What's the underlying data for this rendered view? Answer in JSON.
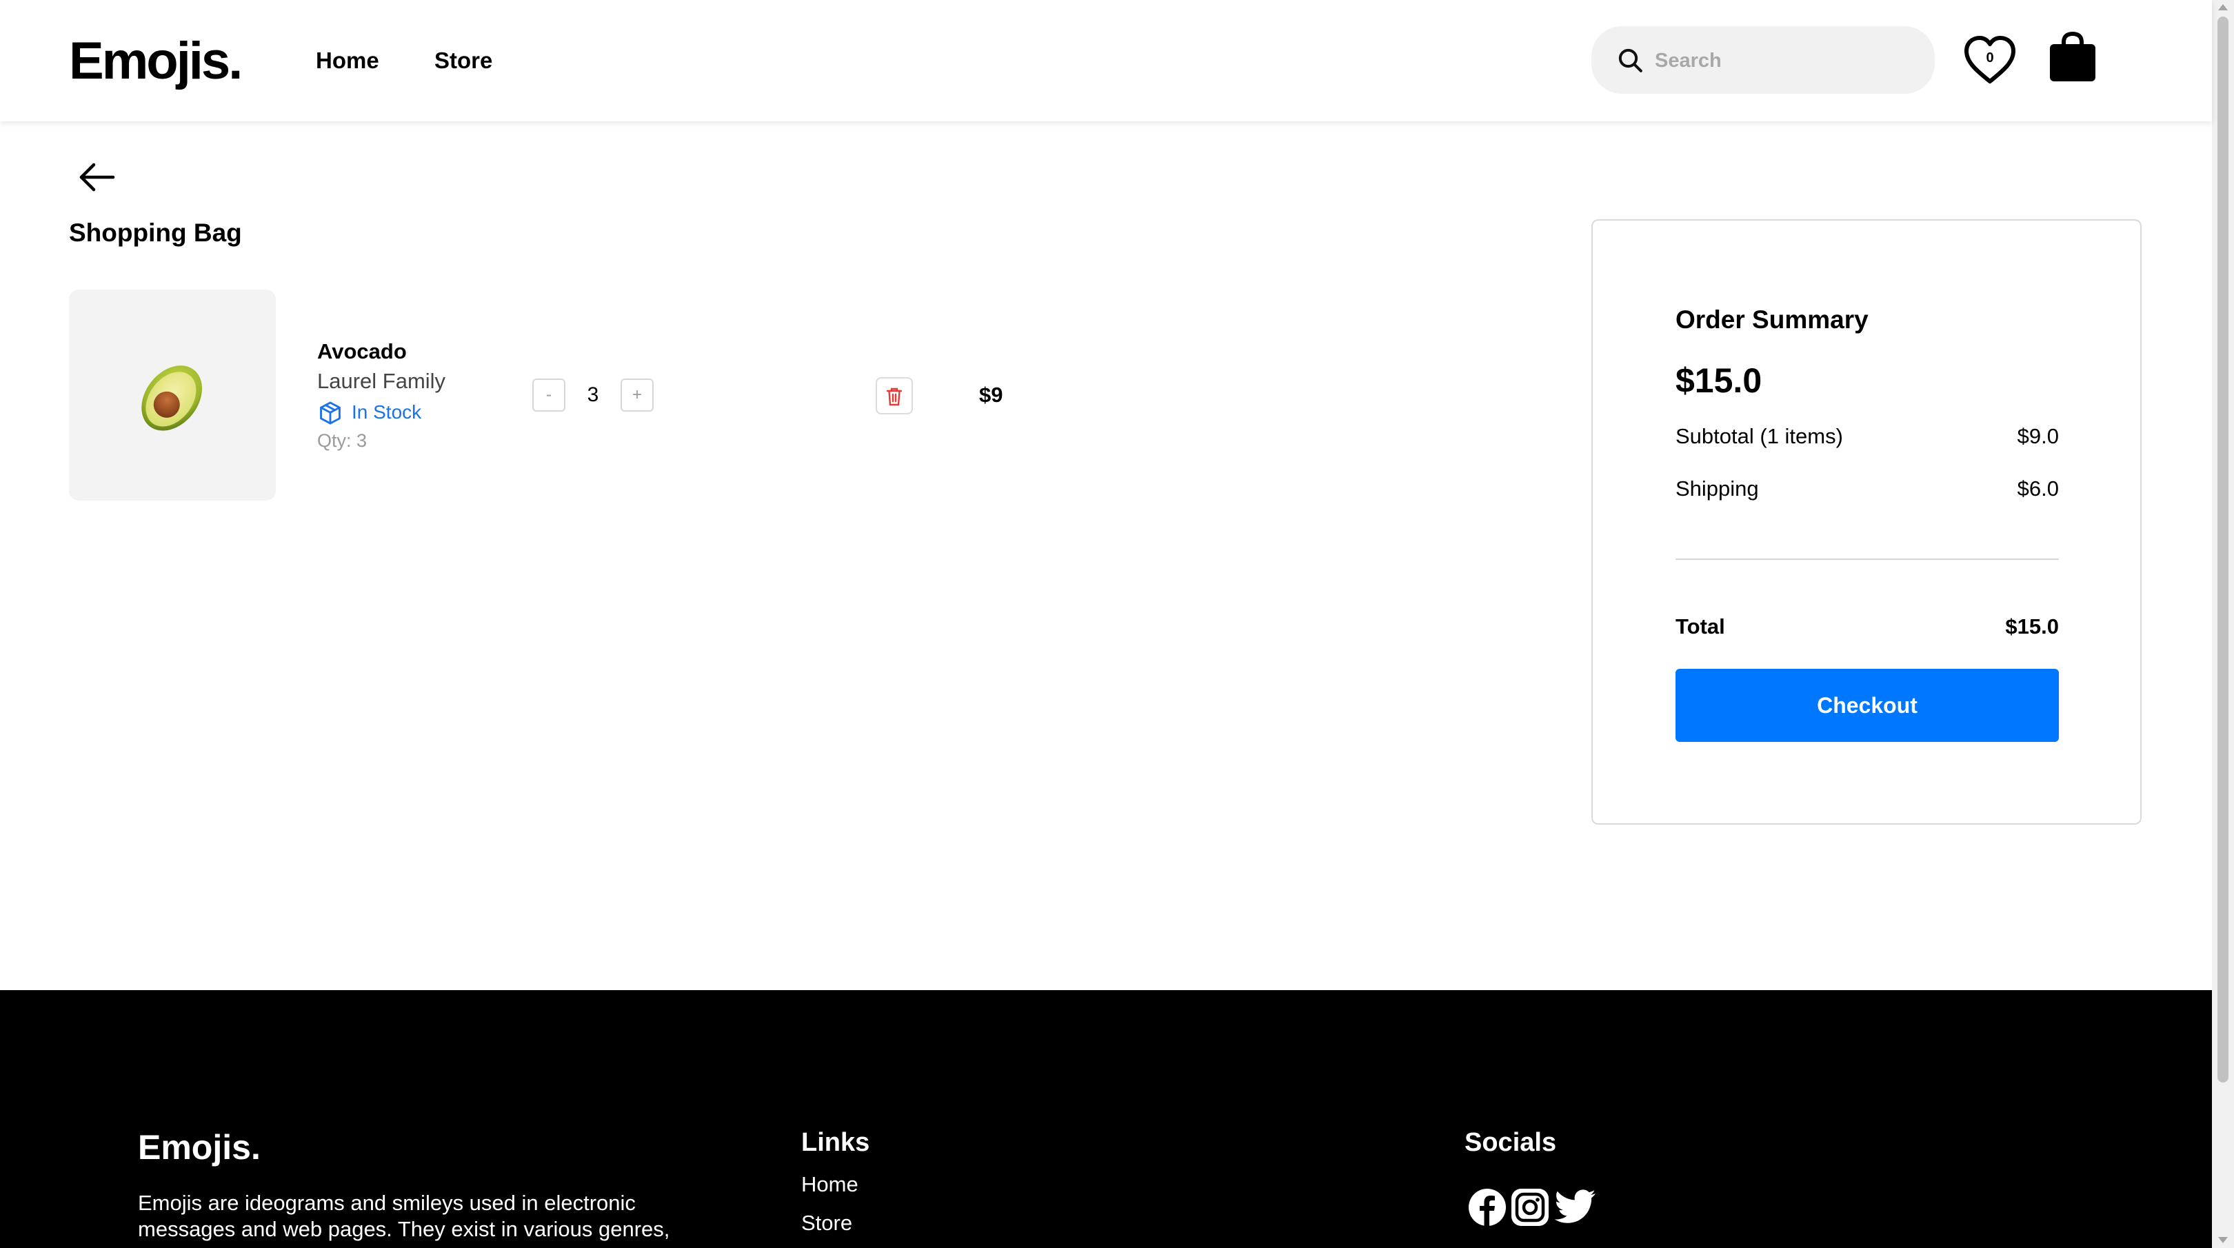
{
  "header": {
    "logo": "Emojis.",
    "nav": {
      "home": "Home",
      "store": "Store"
    },
    "search": {
      "placeholder": "Search",
      "value": ""
    },
    "wishlist_count": "0",
    "icons": {
      "search": "search-icon",
      "wishlist": "heart-icon",
      "bag": "shopping-bag-icon"
    }
  },
  "bag": {
    "title": "Shopping Bag",
    "items": [
      {
        "emoji": "avocado",
        "name": "Avocado",
        "family": "Laurel Family",
        "stock": "In Stock",
        "qty_note": "Qty: 3",
        "quantity": "3",
        "minus_label": "-",
        "plus_label": "+",
        "price": "$9"
      }
    ]
  },
  "summary": {
    "title": "Order Summary",
    "total_big": "$15.0",
    "subtotal_label": "Subtotal (1 items)",
    "subtotal_value": "$9.0",
    "shipping_label": "Shipping",
    "shipping_value": "$6.0",
    "total_label": "Total",
    "total_value": "$15.0",
    "checkout_label": "Checkout"
  },
  "footer": {
    "logo": "Emojis.",
    "description": "Emojis are ideograms and smileys used in electronic messages and web pages. They exist in various genres,",
    "links_heading": "Links",
    "links": [
      "Home",
      "Store"
    ],
    "socials_heading": "Socials",
    "socials": [
      "facebook-icon",
      "instagram-icon",
      "twitter-icon"
    ]
  },
  "colors": {
    "accent": "#0077ff",
    "stock": "#1a73e8",
    "delete": "#e53935",
    "footer_bg": "#000000",
    "search_bg": "#f1f1f1"
  }
}
